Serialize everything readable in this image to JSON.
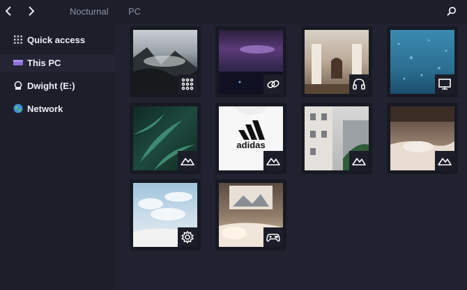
{
  "window": {
    "breadcrumb": [
      "Nocturnal",
      "PC"
    ],
    "back_icon": "‹",
    "forward_icon": "›",
    "search_icon": "search-icon"
  },
  "sidebar": {
    "items": [
      {
        "label": "Quick access",
        "icon": "grid-dots-icon",
        "active": false
      },
      {
        "label": "This PC",
        "icon": "monitor-folder-icon",
        "active": true
      },
      {
        "label": "Dwight (E:)",
        "icon": "lock-drive-icon",
        "active": false
      },
      {
        "label": "Network",
        "icon": "globe-icon",
        "active": false
      }
    ]
  },
  "tiles": [
    {
      "name": "misty-mountains",
      "badge": "apps-grid-icon"
    },
    {
      "name": "night-sea",
      "badge": "link-icon"
    },
    {
      "name": "palace-hall",
      "badge": "headphones-icon"
    },
    {
      "name": "rain-glass",
      "badge": "monitor-icon"
    },
    {
      "name": "fern-leaves",
      "badge": "mountain-icon"
    },
    {
      "name": "adidas-shirt",
      "badge": "mountain-icon"
    },
    {
      "name": "city-building",
      "badge": "mountain-icon"
    },
    {
      "name": "bedroom",
      "badge": "mountain-icon"
    },
    {
      "name": "cloud-room",
      "badge": "gear-icon"
    },
    {
      "name": "bed-poster",
      "badge": "gamepad-icon"
    }
  ],
  "photo_text": {
    "adidas_logo": "adidas"
  },
  "colors": {
    "background": "#1d1f2b",
    "sidebar": "#1c1e2a",
    "active_item": "#232535",
    "tile": "#171923",
    "text": "#eef0f6",
    "muted": "#8f93a5"
  }
}
